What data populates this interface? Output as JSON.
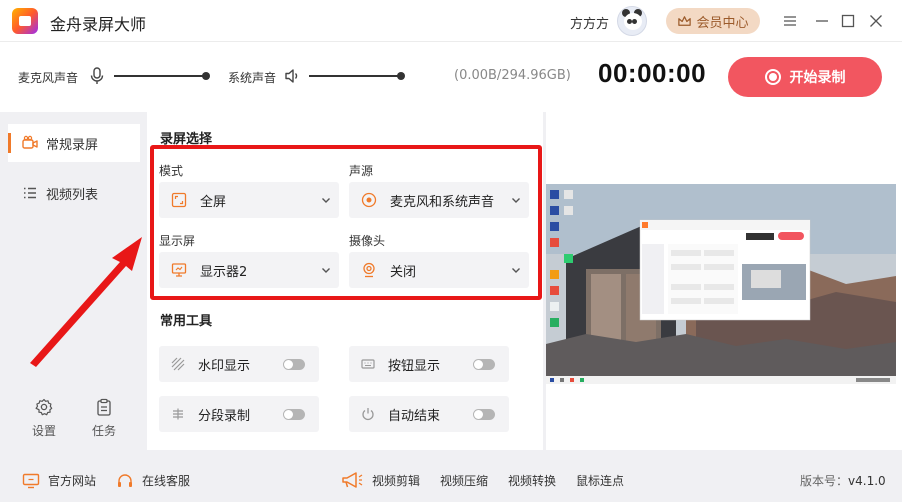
{
  "titlebar": {
    "app_title": "金舟录屏大师",
    "username": "方方方",
    "vip_label": "会员中心"
  },
  "audio": {
    "mic_label": "麦克风声音",
    "system_label": "系统声音",
    "mic_volume_pct": 100,
    "system_volume_pct": 100,
    "storage": "(0.00B/294.96GB)",
    "timer": "00:00:00",
    "record_label": "开始录制"
  },
  "sidebar": {
    "items": [
      {
        "label": "常规录屏",
        "active": true
      },
      {
        "label": "视频列表",
        "active": false
      }
    ],
    "settings_label": "设置",
    "tasks_label": "任务"
  },
  "recording": {
    "section_title": "录屏选择",
    "mode_label": "模式",
    "mode_value": "全屏",
    "audio_source_label": "声源",
    "audio_source_value": "麦克风和系统声音",
    "display_label": "显示屏",
    "display_value": "显示器2",
    "camera_label": "摄像头",
    "camera_value": "关闭"
  },
  "tools": {
    "section_title": "常用工具",
    "items": [
      {
        "label": "水印显示",
        "enabled": false
      },
      {
        "label": "按钮显示",
        "enabled": false
      },
      {
        "label": "分段录制",
        "enabled": false
      },
      {
        "label": "自动结束",
        "enabled": false
      }
    ]
  },
  "footer": {
    "website": "官方网站",
    "support": "在线客服",
    "tools": [
      "视频剪辑",
      "视频压缩",
      "视频转换",
      "鼠标连点"
    ],
    "version_label": "版本号：",
    "version": "v4.1.0"
  },
  "colors": {
    "accent": "#f25660",
    "highlight": "#e81717",
    "vip_bg": "#f3d9c4",
    "sidebar_active": "#f07a2a"
  }
}
